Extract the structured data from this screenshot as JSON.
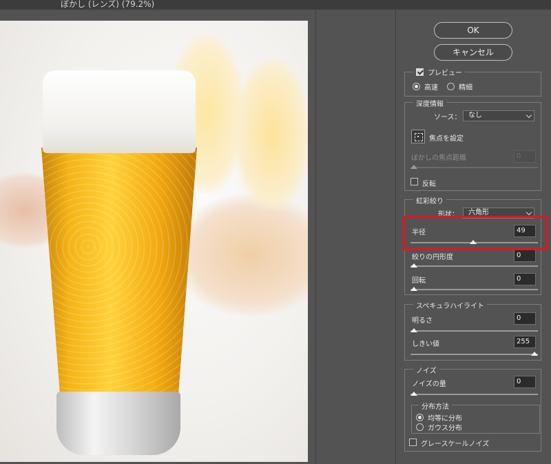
{
  "window": {
    "title": "ぼかし (レンズ) (79.2%)"
  },
  "buttons": {
    "ok": "OK",
    "cancel": "キャンセル"
  },
  "preview_group": {
    "checkbox_label": "プレビュー",
    "checked": true,
    "options": [
      "高速",
      "精細"
    ],
    "selected": "高速"
  },
  "depth_map": {
    "title": "深度情報",
    "source_label": "ソース：",
    "source_value": "なし",
    "set_focus_label": "焦点を設定",
    "blur_focal_distance_label": "ぼかしの焦点距離",
    "blur_focal_distance_value": "0",
    "blur_focal_distance_fraction": 0.0,
    "invert_label": "反転",
    "invert_checked": false
  },
  "iris": {
    "title": "虹彩絞り",
    "shape_label": "形状：",
    "shape_value": "六角形",
    "radius_label": "半径",
    "radius_value": "49",
    "radius_fraction": 0.49,
    "blade_curvature_label": "絞りの円形度",
    "blade_curvature_value": "0",
    "blade_curvature_fraction": 0.0,
    "rotation_label": "回転",
    "rotation_value": "0",
    "rotation_fraction": 0.0
  },
  "specular": {
    "title": "スペキュラハイライト",
    "brightness_label": "明るさ",
    "brightness_value": "0",
    "brightness_fraction": 0.0,
    "threshold_label": "しきい値",
    "threshold_value": "255",
    "threshold_fraction": 1.0
  },
  "noise": {
    "title": "ノイズ",
    "amount_label": "ノイズの量",
    "amount_value": "0",
    "amount_fraction": 0.0,
    "distribution_title": "分布方法",
    "distribution_options": [
      "均等に分布",
      "ガウス分布"
    ],
    "distribution_selected": "均等に分布",
    "monochromatic_label": "グレースケールノイズ",
    "monochromatic_checked": false
  },
  "colors": {
    "panel": "#535353",
    "highlight": "#e5141e",
    "beer": "#f5b416"
  }
}
